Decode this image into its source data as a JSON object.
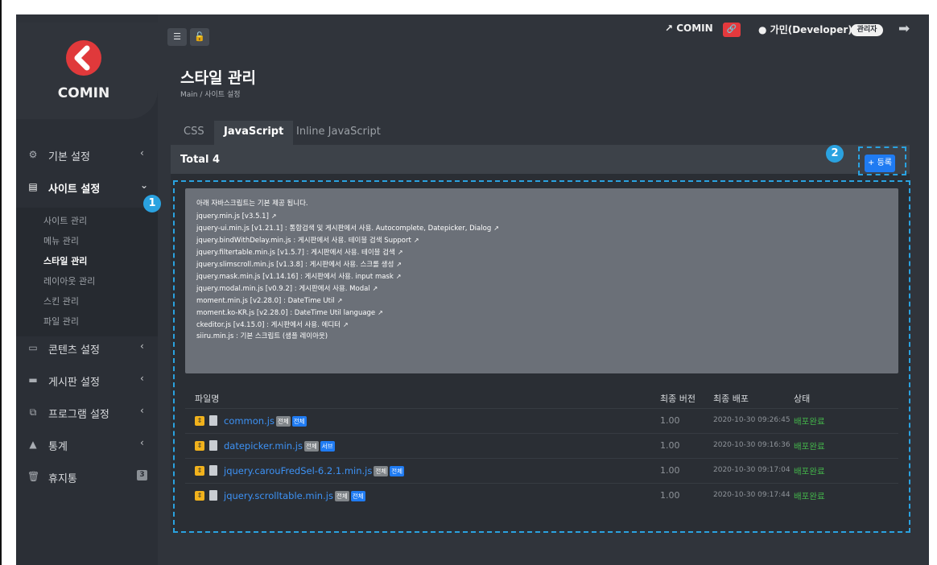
{
  "sidebar": {
    "logo_text": "COMIN",
    "items": [
      {
        "label": "기본 설정",
        "icon": "gears-icon"
      },
      {
        "label": "사이트 설정",
        "icon": "site-icon"
      },
      {
        "label": "콘텐츠 설정",
        "icon": "content-icon"
      },
      {
        "label": "게시판 설정",
        "icon": "board-icon"
      },
      {
        "label": "프로그램 설정",
        "icon": "program-icon"
      },
      {
        "label": "통계",
        "icon": "stats-icon"
      },
      {
        "label": "휴지통",
        "icon": "trash-icon",
        "badge": "3"
      }
    ],
    "sub_items": [
      "사이트 관리",
      "메뉴 관리",
      "스타일 관리",
      "레이아웃 관리",
      "스킨 관리",
      "파일 관리"
    ]
  },
  "header": {
    "site_link": "COMIN",
    "user": "가민(Developer)",
    "role": "관리자"
  },
  "page": {
    "title": "스타일 관리",
    "breadcrumb": "Main  /  사이트 설정"
  },
  "tabs": [
    "CSS",
    "JavaScript",
    "Inline JavaScript"
  ],
  "panel": {
    "total": "Total 4",
    "register_label": "+ 등록"
  },
  "info": {
    "lines": [
      "아래 자바스크립트는 기본 제공 됩니다.",
      "jquery.min.js [v3.5.1]",
      "jquery-ui.min.js [v1.21.1] : 통합검색 및 게시판에서 사용. Autocomplete, Datepicker, Dialog",
      "jquery.bindWithDelay.min.js : 게시판에서 사용. 테이블 검색 Support",
      "jquery.filtertable.min.js [v1.5.7] : 게시판에서 사용. 테이블 검색",
      "jquery.slimscroll.min.js [v1.3.8] : 게시판에서 사용. 스크롤 생성",
      "jquery.mask.min.js [v1.14.16] : 게시판에서 사용. input mask",
      "jquery.modal.min.js [v0.9.2] : 게시판에서 사용. Modal",
      "moment.min.js [v2.28.0] : DateTime Util",
      "moment.ko-KR.js [v2.28.0] : DateTime Util language",
      "ckeditor.js [v4.15.0] : 게시판에서 사용. 에디터",
      "siiru.min.js : 기본 스크립트 (샘플 레이아웃)"
    ]
  },
  "table": {
    "headers": [
      "파일명",
      "최종 버전",
      "최종 배포",
      "상태"
    ],
    "rows": [
      {
        "name": "common.js",
        "tags": [
          "전체",
          "전체"
        ],
        "version": "1.00",
        "deployed": "2020-10-30 09:26:45",
        "status": "배포완료"
      },
      {
        "name": "datepicker.min.js",
        "tags": [
          "전체",
          "서브"
        ],
        "version": "1.00",
        "deployed": "2020-10-30 09:16:36",
        "status": "배포완료"
      },
      {
        "name": "jquery.carouFredSel-6.2.1.min.js",
        "tags": [
          "전체",
          "전체"
        ],
        "version": "1.00",
        "deployed": "2020-10-30 09:17:04",
        "status": "배포완료"
      },
      {
        "name": "jquery.scrolltable.min.js",
        "tags": [
          "전체",
          "전체"
        ],
        "version": "1.00",
        "deployed": "2020-10-30 09:17:44",
        "status": "배포완료"
      }
    ]
  },
  "annotations": [
    "1",
    "2"
  ],
  "colors": {
    "accent": "#1f7bf2",
    "annotation": "#2aa2e0",
    "status_ok": "#43b34a",
    "brand": "#e0393b"
  }
}
